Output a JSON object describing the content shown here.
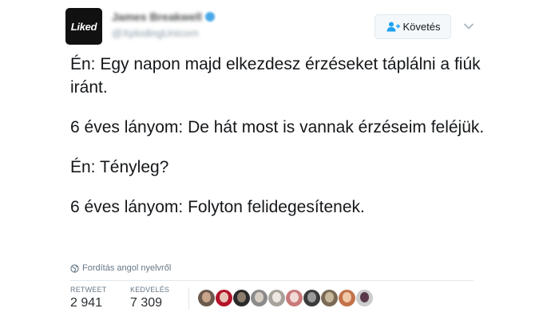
{
  "author": {
    "avatar_text": "Liked",
    "name": "James Breakwell",
    "handle": "@XplodingUnicorn"
  },
  "follow_button": {
    "label": "Követés"
  },
  "tweet": {
    "paragraphs": [
      "Én: Egy napon majd elkezdesz érzéseket táplálni a fiúk iránt.",
      "6 éves lányom: De hát most is vannak érzéseim feléjük.",
      "Én: Tényleg?",
      "6 éves lányom: Folyton felidegesítenek."
    ]
  },
  "translate": {
    "label": "Fordítás angol nyelvről",
    "icon": "globe-icon"
  },
  "stats": {
    "retweets": {
      "label": "RETWEET",
      "value": "2 941"
    },
    "likes": {
      "label": "KEDVELÉS",
      "value": "7 309"
    }
  },
  "likers": [
    {
      "id": "liker-1",
      "colors": [
        "#6b5a4e",
        "#c9a58c"
      ]
    },
    {
      "id": "liker-2",
      "colors": [
        "#b3142a",
        "#e8c4b8"
      ]
    },
    {
      "id": "liker-3",
      "colors": [
        "#2a2a2a",
        "#8c7d6e"
      ]
    },
    {
      "id": "liker-4",
      "colors": [
        "#8a8a8a",
        "#d7cfc6"
      ]
    },
    {
      "id": "liker-5",
      "colors": [
        "#a8a29c",
        "#efe8e2"
      ]
    },
    {
      "id": "liker-6",
      "colors": [
        "#c97a7a",
        "#f2dad6"
      ]
    },
    {
      "id": "liker-7",
      "colors": [
        "#3b3b3b",
        "#9b9b9b"
      ]
    },
    {
      "id": "liker-8",
      "colors": [
        "#7a6a55",
        "#c8b89d"
      ]
    },
    {
      "id": "liker-9",
      "colors": [
        "#c2724a",
        "#f0c8a8"
      ]
    },
    {
      "id": "liker-10",
      "colors": [
        "#cccccc",
        "#5a3a4a"
      ]
    }
  ]
}
